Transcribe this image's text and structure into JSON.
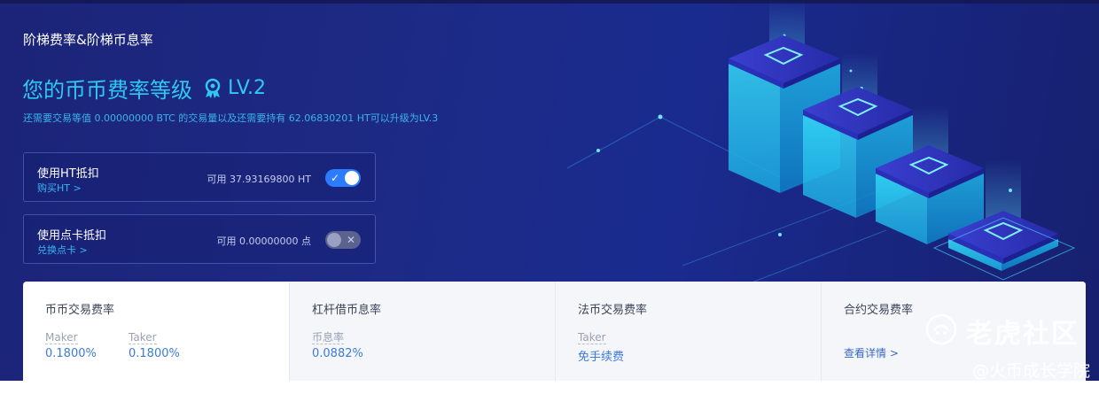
{
  "header": {
    "section_title": "阶梯费率&阶梯币息率",
    "level_title": "您的币币费率等级",
    "level_badge": "LV.2",
    "upgrade_note": "还需要交易等值 0.00000000 BTC 的交易量以及还需要持有 62.06830201 HT可以升级为LV.3"
  },
  "cards": {
    "ht": {
      "title": "使用HT抵扣",
      "link": "购买HT >",
      "available": "可用 37.93169800 HT",
      "toggle_on": true
    },
    "point": {
      "title": "使用点卡抵扣",
      "link": "兑换点卡 >",
      "available": "可用 0.00000000 点",
      "toggle_on": false
    }
  },
  "rates": {
    "spot": {
      "title": "币币交易费率",
      "maker_label": "Maker",
      "maker_value": "0.1800%",
      "taker_label": "Taker",
      "taker_value": "0.1800%"
    },
    "margin": {
      "title": "杠杆借币息率",
      "rate_label": "币息率",
      "rate_value": "0.0882%"
    },
    "fiat": {
      "title": "法币交易费率",
      "taker_label": "Taker",
      "taker_value": "免手续费"
    },
    "contract": {
      "title": "合约交易费率",
      "link": "查看详情 >"
    }
  },
  "watermark": {
    "text": "老虎社区",
    "sub": "@火币成长学院"
  },
  "colors": {
    "accent": "#2ec9f2",
    "toggle_on": "#2b7cff",
    "value_blue": "#3d7bdb",
    "hero_bg": "#1d2a85"
  }
}
